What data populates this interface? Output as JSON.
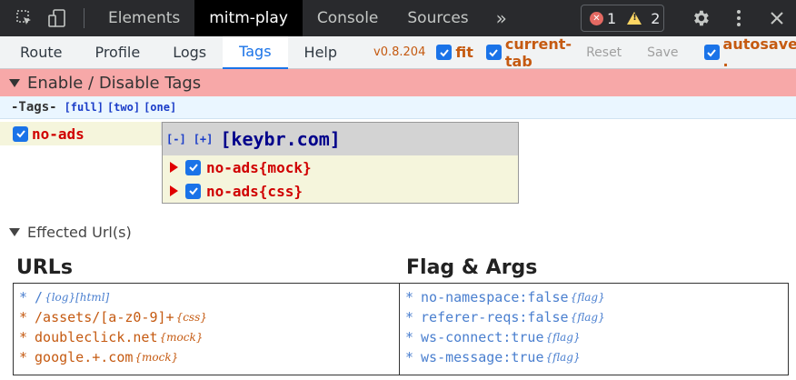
{
  "devtools": {
    "tabs": [
      {
        "label": "Elements",
        "active": false
      },
      {
        "label": "mitm-play",
        "active": true
      },
      {
        "label": "Console",
        "active": false
      },
      {
        "label": "Sources",
        "active": false
      }
    ],
    "more_label": "»",
    "issues": {
      "errors": "1",
      "warnings": "2"
    }
  },
  "nav": {
    "tabs": [
      {
        "label": "Route",
        "active": false
      },
      {
        "label": "Profile",
        "active": false
      },
      {
        "label": "Logs",
        "active": false
      },
      {
        "label": "Tags",
        "active": true
      },
      {
        "label": "Help",
        "active": false
      }
    ],
    "version": "v0.8.204",
    "fit_label": "fit",
    "fit_checked": true,
    "current_tab_label": "current-tab",
    "current_tab_checked": true,
    "reset_label": "Reset",
    "save_label": "Save",
    "autosave_label": "autosave .",
    "autosave_checked": true
  },
  "tags_section": {
    "title": "Enable / Disable Tags",
    "tags_label": "-Tags-",
    "filters": [
      "[full]",
      "[two]",
      "[one]"
    ],
    "tag": {
      "name": "no-ads",
      "checked": true
    },
    "popup": {
      "collapse_label": "[-]",
      "expand_label": "[+]",
      "domain": "[keybr.com]",
      "items": [
        {
          "label": "no-ads{mock}",
          "checked": true
        },
        {
          "label": "no-ads{css}",
          "checked": true
        }
      ]
    }
  },
  "effected": {
    "title": "Effected Url(s)",
    "urls_title": "URLs",
    "flags_title": "Flag & Args",
    "urls": [
      {
        "star": "*",
        "text": "/",
        "flag": "{log}[html]",
        "color": "blue"
      },
      {
        "star": "*",
        "text": "/assets/[a-z0-9]+",
        "flag": "{css}",
        "color": "orange"
      },
      {
        "star": "*",
        "text": "doubleclick.net",
        "flag": "{mock}",
        "color": "orange"
      },
      {
        "star": "*",
        "text": "google.+.com",
        "flag": "{mock}",
        "color": "orange"
      }
    ],
    "flags": [
      {
        "star": "*",
        "text": "no-namespace:false",
        "flag": "{flag}"
      },
      {
        "star": "*",
        "text": "referer-reqs:false",
        "flag": "{flag}"
      },
      {
        "star": "*",
        "text": "ws-connect:true",
        "flag": "{flag}"
      },
      {
        "star": "*",
        "text": "ws-message:true",
        "flag": "{flag}"
      }
    ]
  },
  "colors": {
    "accent": "#1a73e8",
    "orange": "#c55a11",
    "blue": "#4a7fcf",
    "header_pink": "#f7a8a8"
  }
}
